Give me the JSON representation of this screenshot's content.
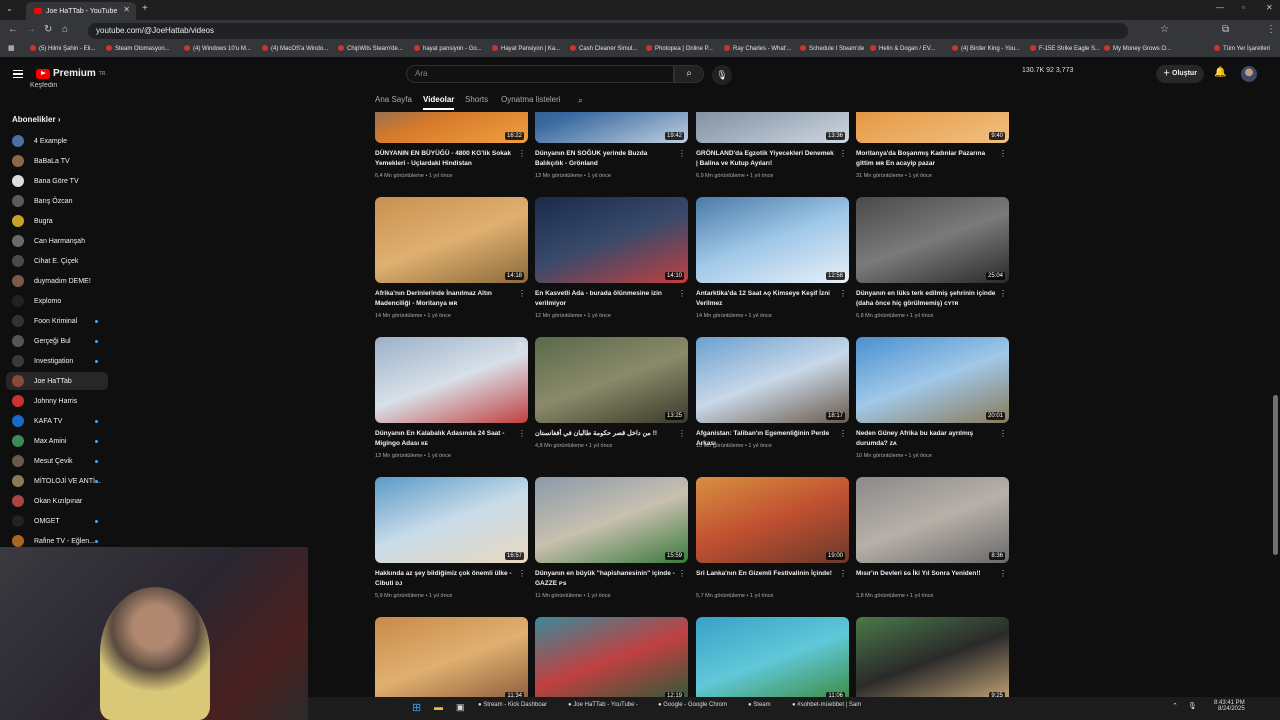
{
  "browser": {
    "tab_title": "Joe HaTTab - YouTube",
    "url": "youtube.com/@JoeHattab/videos",
    "bookmarks": [
      "(5) Hilmi Şahin - Eli...",
      "Steam Otomasyon...",
      "(4) Windows 10'u M...",
      "(4) MacOS'a Windo...",
      "ChipWits Steam'de...",
      "hayat pansiyon - Go...",
      "Hayat Pansiyon | Ka...",
      "Cash Cleaner Simul...",
      "Photopea | Online P...",
      "Ray Charles - What'...",
      "Schedule I Steam'de",
      "Helin & Dogan / EV...",
      "(4) Birder King - You...",
      "F-15E Strike Eagle S...",
      "My Money Grows O..."
    ],
    "bookmarks_more": "Tüm Yer İşaretleri"
  },
  "header": {
    "logo_text": "Premium",
    "logo_sup": "TR",
    "search_placeholder": "Ara",
    "ext_stats": "130.7K   92   3,773",
    "create_label": "Oluştur"
  },
  "sidebar": {
    "cut_item": "Keşfedin",
    "section_title": "Abonelikler",
    "section_chevron": "›",
    "items": [
      {
        "label": "4 Example",
        "color": "#4a6fa5",
        "dot": false
      },
      {
        "label": "BaBaLa TV",
        "color": "#8a6a4a",
        "dot": false
      },
      {
        "label": "Bana Göre TV",
        "color": "#dddddd",
        "dot": false
      },
      {
        "label": "Barış Özcan",
        "color": "#5a5a5a",
        "dot": false
      },
      {
        "label": "Bugra",
        "color": "#c9a227",
        "dot": false
      },
      {
        "label": "Can Harmanşah",
        "color": "#6a6a6a",
        "dot": false
      },
      {
        "label": "Cihat E. Çiçek",
        "color": "#4a4a4a",
        "dot": false
      },
      {
        "label": "duymadım DEME!",
        "color": "#7a5a4a",
        "dot": false
      },
      {
        "label": "Explomo",
        "color": "#222222",
        "dot": false
      },
      {
        "label": "Foon Kriminal",
        "color": "#333333",
        "dot": true
      },
      {
        "label": "Gerçeği Bul",
        "color": "#555555",
        "dot": true
      },
      {
        "label": "Investigation",
        "color": "#3a3a3a",
        "dot": true
      },
      {
        "label": "Joe HaTTab",
        "color": "#8a4a3a",
        "dot": false
      },
      {
        "label": "Johnny Harris",
        "color": "#c33",
        "dot": false
      },
      {
        "label": "KAFA TV",
        "color": "#1a6acb",
        "dot": true
      },
      {
        "label": "Max Amini",
        "color": "#3a8a5a",
        "dot": true
      },
      {
        "label": "Mesut Çevik",
        "color": "#6a5a4a",
        "dot": true
      },
      {
        "label": "MİTOLOJİ VE ANTİ...",
        "color": "#8a7a5a",
        "dot": true
      },
      {
        "label": "Okan Kızılpınar",
        "color": "#aa4444",
        "dot": false
      },
      {
        "label": "OMGET",
        "color": "#222222",
        "dot": true
      },
      {
        "label": "Rafine TV - Eğlen...",
        "color": "#aa6622",
        "dot": true
      }
    ]
  },
  "channel_tabs": {
    "home": "Ana Sayfa",
    "videos": "Videolar",
    "shorts": "Shorts",
    "playlists": "Oynatma listeleri"
  },
  "videos": [
    {
      "title": "DÜNYANIN EN BÜYÜĞÜ - 4800 KG'lik Sokak Yemekleri - Uçlardaki Hindistan",
      "views": "6,4 Mn görüntüleme",
      "age": "1 yıl önce",
      "duration": "16:22",
      "bg": "linear-gradient(160deg,#2a5a8a,#d67a2a 60%,#f0a040)"
    },
    {
      "title": "Dünyanın EN SOĞUK yerinde Buzda Balıkçılık - Grönland",
      "views": "13 Mn görüntüleme",
      "age": "1 yıl önce",
      "duration": "19:42",
      "bg": "linear-gradient(160deg,#1a3a6a,#3a6aa0 50%,#c0d0e0)"
    },
    {
      "title": "GRÖNLAND'da Egzotik Yiyecekleri Denemek | Balina ve Kutup Ayıları!",
      "views": "6,9 Mn görüntüleme",
      "age": "1 yıl önce",
      "duration": "13:36",
      "bg": "linear-gradient(160deg,#5a6a7a,#9aa8b8 60%,#d0d8e0)"
    },
    {
      "title": "Moritanya'da Boşanmış Kadınlar Pazarına gittim ᴍʀ En acayip pazar",
      "views": "31 Mn görüntüleme",
      "age": "1 yıl önce",
      "duration": "9:40",
      "bg": "linear-gradient(160deg,#d06a2a,#e8a050 50%,#f0c080)"
    },
    {
      "title": "Afrika'nın Derinlerinde İnanılmaz Altın Madenciliği - Moritanya ᴍʀ",
      "views": "14 Mn görüntüleme",
      "age": "1 yıl önce",
      "duration": "14:18",
      "bg": "linear-gradient(160deg,#c89050,#e0b070 50%,#8a6a3a)"
    },
    {
      "title": "En Kasvetli Ada - burada ölünmesine izin verilmiyor",
      "views": "12 Mn görüntüleme",
      "age": "1 yıl önce",
      "duration": "14:10",
      "bg": "linear-gradient(160deg,#1a2a4a,#3a4a6a 50%,#c04040)"
    },
    {
      "title": "Antarktika'da 12 Saat ᴀǫ Kimseye Keşif İzni Verilmez",
      "views": "14 Mn görüntüleme",
      "age": "1 yıl önce",
      "duration": "12:58",
      "bg": "linear-gradient(160deg,#4a7aa8,#a0c8e8 50%,#e8f0f8)"
    },
    {
      "title": "Dünyanın en lüks terk edilmiş şehrinin içinde (daha önce hiç görülmemiş) ᴄʏᴛʀ",
      "views": "6,8 Mn görüntüleme",
      "age": "1 yıl önce",
      "duration": "25:04",
      "bg": "linear-gradient(160deg,#4a4a4a,#7a7a7a 50%,#2a2a2a)"
    },
    {
      "title": "Dünyanın En Kalabalık Adasında 24 Saat - Migingo Adası ᴋᴇ",
      "views": "13 Mn görüntüleme",
      "age": "1 yıl önce",
      "duration": "",
      "bg": "linear-gradient(160deg,#9ab0c8,#d8e0e8 50%,#c04040)"
    },
    {
      "title": "من داخل قصر حكومة طالبان في أفغانستان !!",
      "views": "4,8 Mn görüntüleme",
      "age": "1 yıl önce",
      "duration": "13:25",
      "bg": "linear-gradient(160deg,#5a6a4a,#8a8a6a 50%,#3a3a2a)"
    },
    {
      "title": "Afganistan: Taliban'ın Egemenliğinin Perde Arkası",
      "views": "13 Mn görüntüleme",
      "age": "1 yıl önce",
      "duration": "18:17",
      "bg": "linear-gradient(160deg,#6aa0d0,#c8d8e8 50%,#6a5a4a)"
    },
    {
      "title": "Neden Güney Afrika bu kadar ayrılmış durumda? ᴢᴀ",
      "views": "10 Mn görüntüleme",
      "age": "1 yıl önce",
      "duration": "20:01",
      "bg": "linear-gradient(160deg,#4a90d0,#a0c8e8 50%,#8a7a5a)"
    },
    {
      "title": "Hakkında az şey bildiğimiz çok önemli ülke - Cibuti ᴅᴊ",
      "views": "5,9 Mn görüntüleme",
      "age": "1 yıl önce",
      "duration": "16:57",
      "bg": "linear-gradient(160deg,#5a9ac8,#c8dce8 50%,#e8d8c0)"
    },
    {
      "title": "Dünyanın en büyük \"hapishanesinin\" içinde - GAZZE ᴘs",
      "views": "11 Mn görüntüleme",
      "age": "1 yıl önce",
      "duration": "15:59",
      "bg": "linear-gradient(160deg,#8a9aa8,#c8c0b0 50%,#3a7a3a)"
    },
    {
      "title": "Sri Lanka'nın En Gizemli Festivalinin İçinde!",
      "views": "5,7 Mn görüntüleme",
      "age": "1 yıl önce",
      "duration": "19:00",
      "bg": "linear-gradient(160deg,#d89040,#c05030 50%,#6a3a2a)"
    },
    {
      "title": "Mısır'ın Devleri ᴇɢ İki Yıl Sonra Yeniden!!",
      "views": "3,8 Mn görüntüleme",
      "age": "1 yıl önce",
      "duration": "8:36",
      "bg": "linear-gradient(160deg,#8a8a8a,#b8b0a8 50%,#6a6a6a)"
    },
    {
      "title": "",
      "views": "",
      "age": "",
      "duration": "11:34",
      "bg": "linear-gradient(160deg,#c88a4a,#e0b070 50%,#8a5a3a)"
    },
    {
      "title": "",
      "views": "",
      "age": "",
      "duration": "12:19",
      "bg": "linear-gradient(160deg,#3a8a9a,#c04040 50%,#2a5a3a)"
    },
    {
      "title": "",
      "views": "",
      "age": "",
      "duration": "11:06",
      "bg": "linear-gradient(160deg,#3aa0c8,#60c8d8 50%,#3a8a3a)"
    },
    {
      "title": "",
      "views": "",
      "age": "",
      "duration": "9:25",
      "bg": "linear-gradient(160deg,#4a7a4a,#2a2a2a 50%,#c8a878)"
    }
  ],
  "taskbar": {
    "items": [
      "Stream - Kick Dashboar",
      "Joe HaTTab - YouTube -",
      "Google - Google Chrom",
      "Steam",
      "#sohbet-müebbet | Sam"
    ],
    "time": "8:43:41 PM",
    "date": "8/24/2025"
  }
}
